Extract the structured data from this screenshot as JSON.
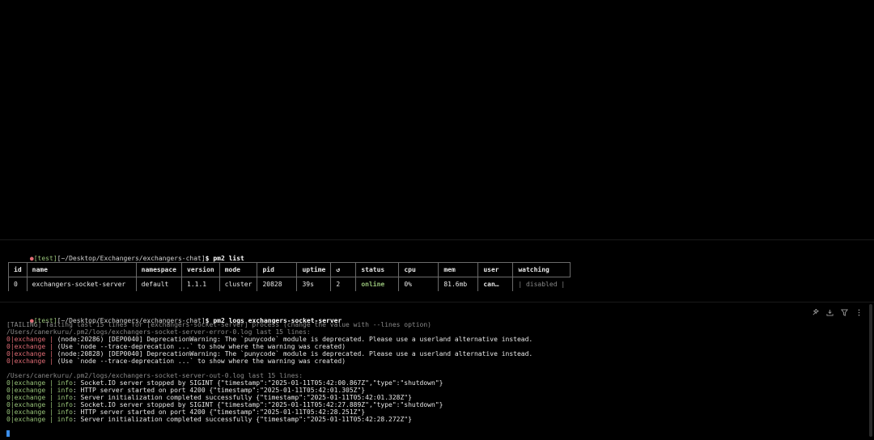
{
  "prompt": {
    "dot": "●",
    "tag": "[test]",
    "path": "[~/Desktop/Exchangers/exchangers-chat]",
    "symbol": "$"
  },
  "commands": {
    "list": "pm2 list",
    "logs": "pm2 logs exchangers-socket-server"
  },
  "pm2_table": {
    "headers": [
      "id",
      "name",
      "namespace",
      "version",
      "mode",
      "pid",
      "uptime",
      "↺",
      "status",
      "cpu",
      "mem",
      "user",
      "watching"
    ],
    "row": {
      "id": "0",
      "name": "exchangers-socket-server",
      "namespace": "default",
      "version": "1.1.1",
      "mode": "cluster",
      "pid": "20828",
      "uptime": "39s",
      "restarts": "2",
      "status": "online",
      "cpu": "0%",
      "mem": "81.6mb",
      "user": "can…",
      "watching": "| disabled |"
    }
  },
  "logs": {
    "tailing": "[TAILING] Tailing last 15 lines for [exchangers-socket-server] process (change the value with --lines option)",
    "error_file": "/Users/canerkuru/.pm2/logs/exchangers-socket-server-error-0.log last 15 lines:",
    "prefix": "0|exchange",
    "separator": " | ",
    "error_lines": [
      "(node:20286) [DEP0040] DeprecationWarning: The `punycode` module is deprecated. Please use a userland alternative instead.",
      "(Use `node --trace-deprecation ...` to show where the warning was created)",
      "(node:20828) [DEP0040] DeprecationWarning: The `punycode` module is deprecated. Please use a userland alternative instead.",
      "(Use `node --trace-deprecation ...` to show where the warning was created)"
    ],
    "out_file": "/Users/canerkuru/.pm2/logs/exchangers-socket-server-out-0.log last 15 lines:",
    "info_label": "info",
    "out_lines": [
      ": Socket.IO server stopped by SIGINT {\"timestamp\":\"2025-01-11T05:42:00.867Z\",\"type\":\"shutdown\"}",
      ": HTTP server started on port 4200 {\"timestamp\":\"2025-01-11T05:42:01.305Z\"}",
      ": Server initialization completed successfully {\"timestamp\":\"2025-01-11T05:42:01.328Z\"}",
      ": Socket.IO server stopped by SIGINT {\"timestamp\":\"2025-01-11T05:42:27.889Z\",\"type\":\"shutdown\"}",
      ": HTTP server started on port 4200 {\"timestamp\":\"2025-01-11T05:42:28.251Z\"}",
      ": Server initialization completed successfully {\"timestamp\":\"2025-01-11T05:42:28.272Z\"}"
    ]
  },
  "colors": {
    "background": "#000000",
    "prompt_dot": "#e06c75",
    "prompt_tag": "#98c379",
    "online": "#98c379",
    "error_prefix": "#e06c75",
    "info_prefix": "#98c379",
    "cursor": "#3b8eea"
  },
  "toolbar_icons": [
    "sparkle-icon",
    "download-icon",
    "filter-icon",
    "more-vertical-icon"
  ]
}
